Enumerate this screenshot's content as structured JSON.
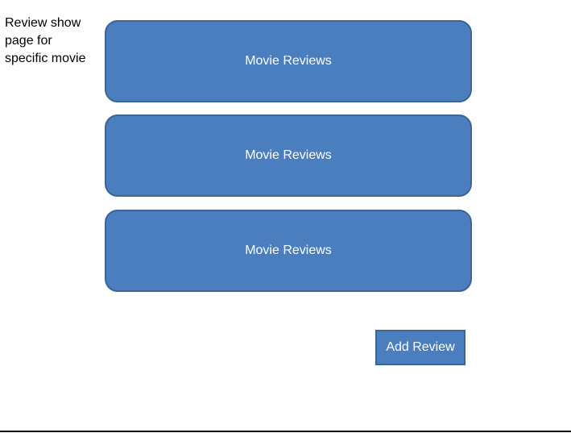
{
  "page": {
    "caption": "Review show\npage for\nspecific movie"
  },
  "reviews": [
    {
      "label": "Movie Reviews"
    },
    {
      "label": "Movie Reviews"
    },
    {
      "label": "Movie Reviews"
    }
  ],
  "actions": {
    "add_review_label": "Add Review"
  },
  "colors": {
    "card_fill": "#4a7ebf",
    "card_border": "#3a6594",
    "text_on_card": "#ffffff"
  }
}
